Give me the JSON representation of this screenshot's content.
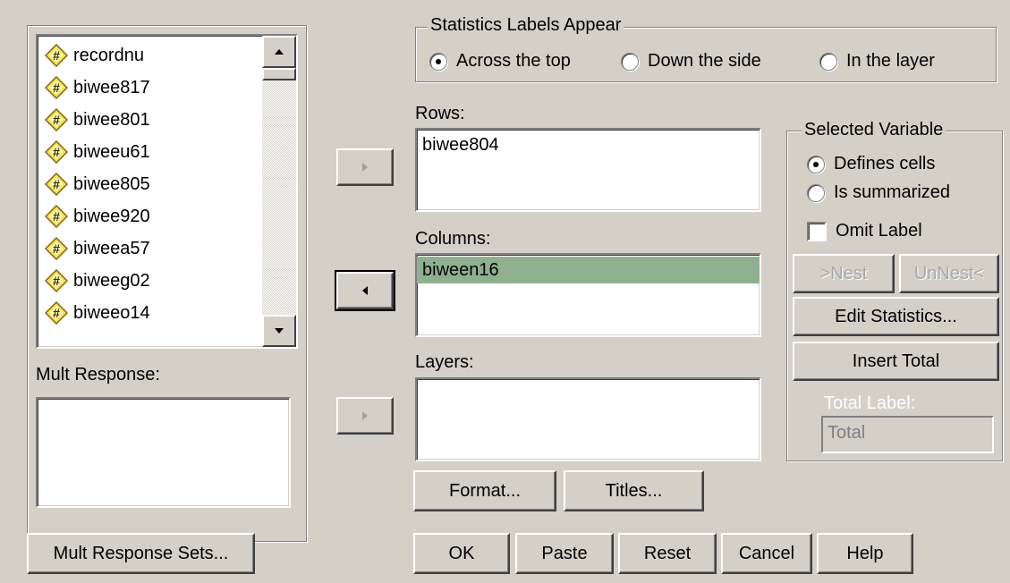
{
  "variables": [
    "recordnu",
    "biwee817",
    "biwee801",
    "biweeu61",
    "biwee805",
    "biwee920",
    "biweea57",
    "biweeg02",
    "biweeo14"
  ],
  "mult_response": {
    "label": "Mult Response:"
  },
  "stat_labels": {
    "title": "Statistics Labels Appear",
    "options": [
      "Across the top",
      "Down the side",
      "In the layer"
    ],
    "selected": "Across the top"
  },
  "rows": {
    "label": "Rows:",
    "items": [
      "biwee804"
    ]
  },
  "columns": {
    "label": "Columns:",
    "items": [
      "biween16"
    ]
  },
  "layers": {
    "label": "Layers:",
    "items": []
  },
  "selected_variable": {
    "title": "Selected Variable",
    "options": [
      "Defines cells",
      "Is summarized"
    ],
    "selected": "Defines cells",
    "omit_label": "Omit Label",
    "nest": ">Nest",
    "unnest": "UnNest<",
    "edit_statistics": "Edit Statistics...",
    "insert_total": "Insert Total",
    "total_label": "Total Label:",
    "total_value": "Total"
  },
  "buttons": {
    "mult_response_sets": "Mult Response Sets...",
    "format": "Format...",
    "titles": "Titles...",
    "ok": "OK",
    "paste": "Paste",
    "reset": "Reset",
    "cancel": "Cancel",
    "help": "Help"
  },
  "colors": {
    "selection": "#8fb08f",
    "face": "#d4d0c8"
  },
  "icons": {
    "variable": "numeric-variable-icon"
  }
}
